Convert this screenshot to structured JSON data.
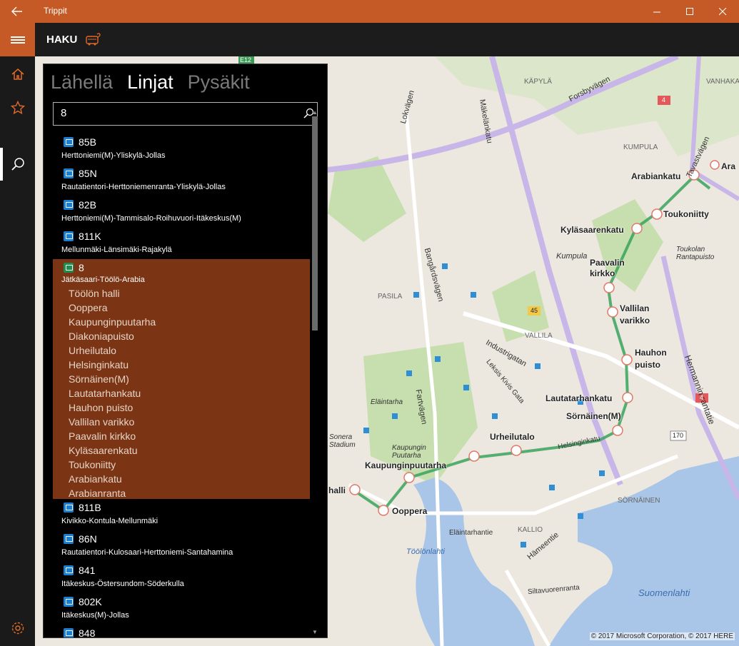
{
  "window": {
    "title": "Trippit"
  },
  "header": {
    "title": "HAKU"
  },
  "tabs": [
    {
      "label": "Lähellä",
      "active": false
    },
    {
      "label": "Linjat",
      "active": true
    },
    {
      "label": "Pysäkit",
      "active": false
    }
  ],
  "search": {
    "value": "8"
  },
  "lines": [
    {
      "number": "85B",
      "route": "Herttoniemi(M)-Yliskylä-Jollas"
    },
    {
      "number": "85N",
      "route": "Rautatientori-Herttoniemenranta-Yliskylä-Jollas"
    },
    {
      "number": "82B",
      "route": "Herttoniemi(M)-Tammisalo-Roihuvuori-Itäkeskus(M)"
    },
    {
      "number": "811K",
      "route": "Mellunmäki-Länsimäki-Rajakylä"
    }
  ],
  "expanded_line": {
    "number": "8",
    "route": "Jätkäsaari-Töölö-Arabia",
    "stops": [
      "Töölön halli",
      "Ooppera",
      "Kaupunginpuutarha",
      "Diakoniapuisto",
      "Urheilutalo",
      "Helsinginkatu",
      "Sörnäinen(M)",
      "Lautatarhankatu",
      "Hauhon puisto",
      "Vallilan varikko",
      "Paavalin kirkko",
      "Kyläsaarenkatu",
      "Toukoniitty",
      "Arabiankatu",
      "Arabianranta"
    ]
  },
  "lines_after": [
    {
      "number": "811B",
      "route": "Kivikko-Kontula-Mellunmäki"
    },
    {
      "number": "86N",
      "route": "Rautatientori-Kulosaari-Herttoniemi-Santahamina"
    },
    {
      "number": "841",
      "route": "Itäkeskus-Östersundom-Söderkulla"
    },
    {
      "number": "802K",
      "route": "Itäkeskus(M)-Jollas"
    },
    {
      "number": "848",
      "route": ""
    }
  ],
  "map": {
    "copyright": "© 2017 Microsoft Corporation, © 2017 HERE",
    "stop_labels": [
      "Arabiankatu",
      "Ara",
      "Toukoniitty",
      "Kyläsaarenkatu",
      "Paavalin kirkko",
      "Vallilan varikko",
      "Hauhon puisto",
      "Lautatarhankatu",
      "Sörnäinen(M)",
      "Urheilutalo",
      "Kaupunginpuutarha",
      "halli",
      "Ooppera"
    ],
    "area_labels": [
      "KÄPYLÄ",
      "KUMPULA",
      "Kumpula",
      "VALLILA",
      "PASILA",
      "KALLIO",
      "SÖRNÄINEN",
      "Eläintarha",
      "Kaupungin Puutarha",
      "Sonera Stadium",
      "Töölönlahti",
      "Toukolan Rantapuisto",
      "VANHAKA",
      "Suomenlahti"
    ],
    "street_labels": [
      "Mäkelänkatu",
      "Forsbyvägen",
      "Lokvägen",
      "Bangårdsvägen",
      "Industrigatan",
      "Fartvägen",
      "Hermannin rantatie",
      "Tavastvägen",
      "Helsinginkatu",
      "Eläintarhantie",
      "Hämeentie",
      "Siltavuorenranta",
      "Leksis Kivis Gata"
    ],
    "road_numbers": [
      "E12",
      "4",
      "45",
      "4",
      "170",
      "45"
    ],
    "route_color": "#3aa35c"
  },
  "colors": {
    "accent": "#c55a26",
    "expanded_bg": "#7b3514",
    "bus": "#1a7fd1",
    "tram": "#1f8d4d"
  }
}
